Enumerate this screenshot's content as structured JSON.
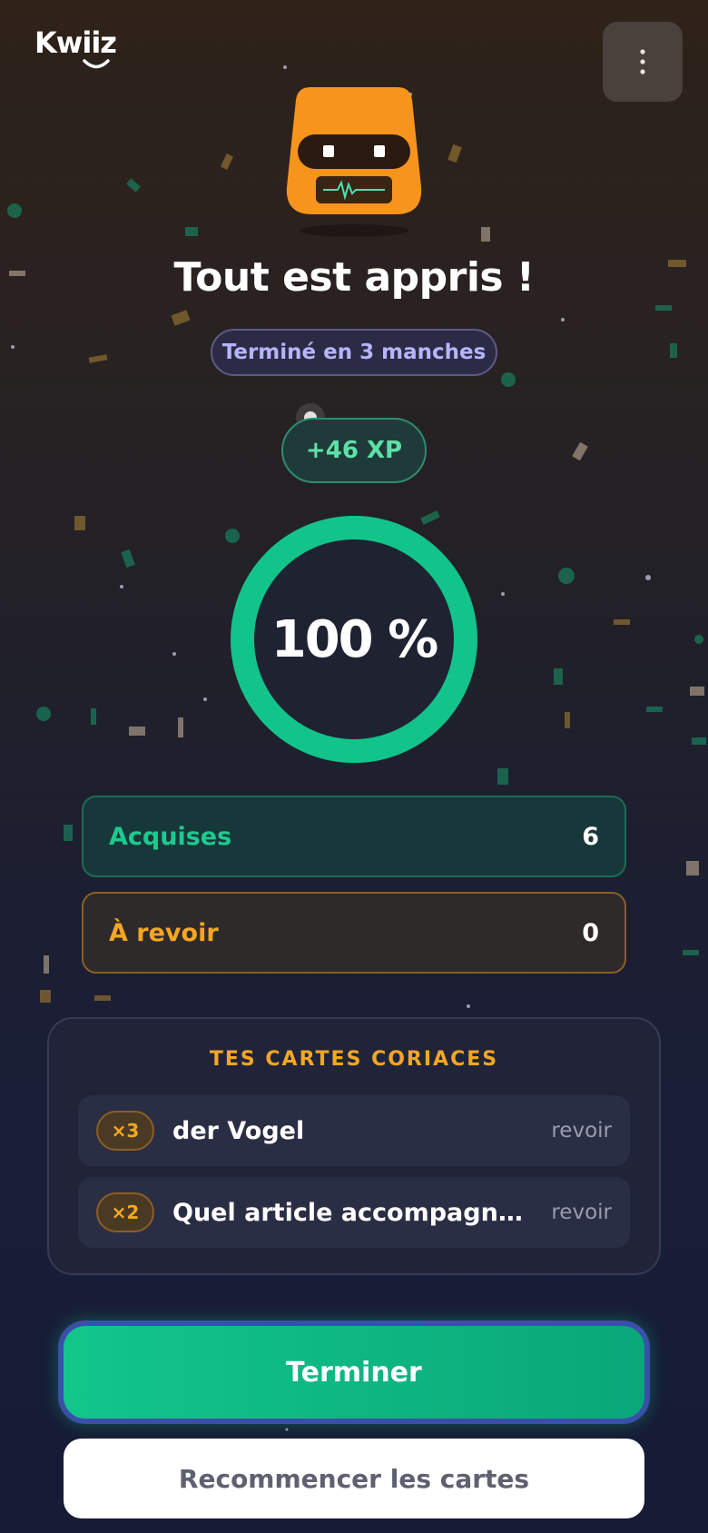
{
  "app": {
    "logo_text": "Kwiiz"
  },
  "header": {
    "menu_icon": "more-vertical-icon"
  },
  "result": {
    "title": "Tout est appris !",
    "rounds_label": "Terminé en 3 manches",
    "xp_label": "+46 XP",
    "score_label": "100 %",
    "score_fraction": 1.0
  },
  "stats": {
    "known_label": "Acquises",
    "known_value": "6",
    "review_label": "À revoir",
    "review_value": "0"
  },
  "hard_cards": {
    "title": "TES CARTES CORIACES",
    "items": [
      {
        "count": "×3",
        "text": "der Vogel",
        "action": "revoir"
      },
      {
        "count": "×2",
        "text": "Quel article accompagne « K…",
        "action": "revoir"
      }
    ]
  },
  "actions": {
    "finish_label": "Terminer",
    "restart_label": "Recommencer les cartes"
  },
  "colors": {
    "accent_green": "#12c68a",
    "accent_orange": "#f5a623",
    "accent_purple": "#b6b4ff",
    "mascot_orange": "#f7941d"
  }
}
